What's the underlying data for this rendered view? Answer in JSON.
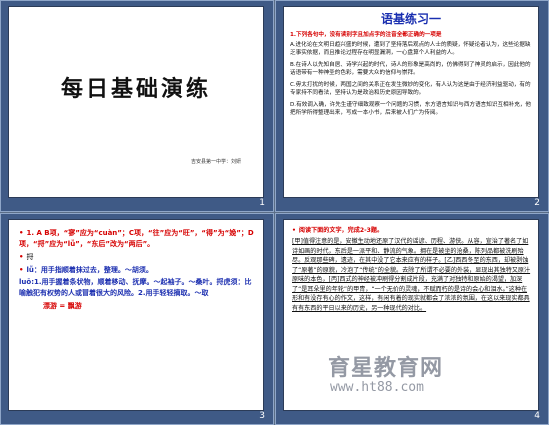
{
  "slides": [
    {
      "number": "1",
      "title": "每日基础演练",
      "subtitle": "吉安县第一中学：刘妍"
    },
    {
      "number": "2",
      "title": "语基练习一",
      "question": "1.下列各句中，没有读别字且加点字的注音全都正确的一项是",
      "options": [
        "A.进化论在文明日趋兴盛的时候，遭到了坚持落后观点的人士的质疑，怀疑论者认为，这些论据缺乏事实依据，而且推论过程存在明显漏洞，一心盘算个人利益的人。",
        "B.在诗人以先知自居、诗学兴起的时代，诗人的形象是高尚的，仿佛得到了神灵的启示，因此他的话语带有一种神圣的色彩，需要大众的信仰与崇拜。",
        "C.毋太打扰的时候，两国之间的关系正在发生微妙的变化，有人认为这是由于经济利益驱动，有的专家持不同看法，坚持认为是政治和历史原因导致的。",
        "D.有效调入确，许先生谨守细致观察一个问题的习惯，东方语言知识与西方语言知识互相补充，他把所学所得整理出来，写成一本小书，后来被人们广为传阅。"
      ]
    },
    {
      "number": "3",
      "lines": [
        "1. A  B项，“寥”应为“cuàn”；C项，“往”应为“旺”，“得”为“娩”；D项，“捋”应为“lǚ”，“东后”改为“两后”。",
        "捋",
        "lǚ：用手指顺着抹过去，整理。～胡须。",
        "luō:1.用手握着条状物，顺着移动、抚摩。～起袖子。～桑叶。捋虎须：比喻触犯有权势的人或冒着很大的风险。2.用手轻轻摘取。～取",
        "漂游 = 飘游"
      ]
    },
    {
      "number": "4",
      "heading": "阅读下面的文字，完成2-3题。",
      "paragraph": "[甲]值得注意的是，安徽生动地还原了汉代的谣谚、历程、游侠。从容，宣治了著名了如诗如画的时代，东后是一派平和、静流的气象。拥在是被坐的沧桑，陈列品都被洗刷殆尽。反观那些碑，遗迹，在其中没了它本来应有的样子。[乙]西西冬至的东西，却被剥蚀了“原著”的原貌，冷泡了“传统”的全貌。去除了所谓不必要的外装，显现出其独特又原汁原味的本色，[丙]西式的神经被冲刷得分割成片段，充满了对独特和原始的渴望，加深了“是耳朵里的年轮”的甲冑，“一个无价的灵魂，不赋而朽的是诗的会心和泪水。”这种在形和有没存有心的作文，这样，有闲有着的现实就都会了浓浓的氛围，在这以来现实都具有有东西的平日以来的历史，另一种现代的对比。"
    }
  ],
  "watermark": {
    "brand": "育星教育网",
    "url": "www.ht88.com"
  }
}
